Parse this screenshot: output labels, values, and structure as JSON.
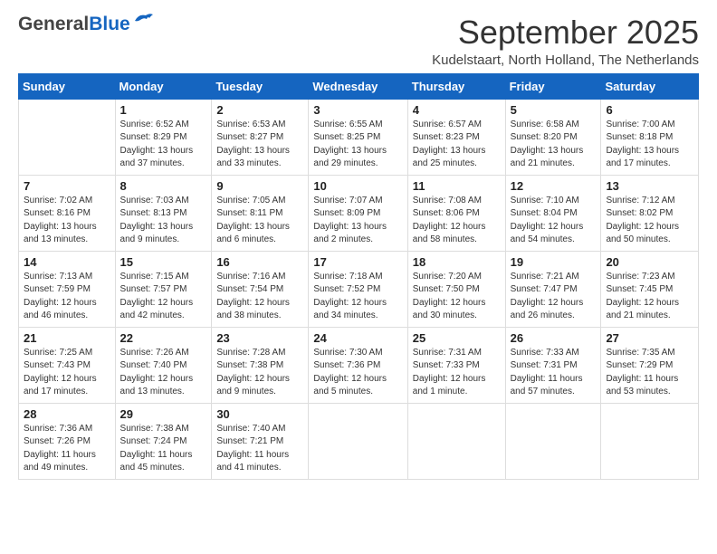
{
  "header": {
    "logo_general": "General",
    "logo_blue": "Blue",
    "month_title": "September 2025",
    "location": "Kudelstaart, North Holland, The Netherlands"
  },
  "days_of_week": [
    "Sunday",
    "Monday",
    "Tuesday",
    "Wednesday",
    "Thursday",
    "Friday",
    "Saturday"
  ],
  "weeks": [
    [
      {
        "day": "",
        "info": ""
      },
      {
        "day": "1",
        "info": "Sunrise: 6:52 AM\nSunset: 8:29 PM\nDaylight: 13 hours\nand 37 minutes."
      },
      {
        "day": "2",
        "info": "Sunrise: 6:53 AM\nSunset: 8:27 PM\nDaylight: 13 hours\nand 33 minutes."
      },
      {
        "day": "3",
        "info": "Sunrise: 6:55 AM\nSunset: 8:25 PM\nDaylight: 13 hours\nand 29 minutes."
      },
      {
        "day": "4",
        "info": "Sunrise: 6:57 AM\nSunset: 8:23 PM\nDaylight: 13 hours\nand 25 minutes."
      },
      {
        "day": "5",
        "info": "Sunrise: 6:58 AM\nSunset: 8:20 PM\nDaylight: 13 hours\nand 21 minutes."
      },
      {
        "day": "6",
        "info": "Sunrise: 7:00 AM\nSunset: 8:18 PM\nDaylight: 13 hours\nand 17 minutes."
      }
    ],
    [
      {
        "day": "7",
        "info": "Sunrise: 7:02 AM\nSunset: 8:16 PM\nDaylight: 13 hours\nand 13 minutes."
      },
      {
        "day": "8",
        "info": "Sunrise: 7:03 AM\nSunset: 8:13 PM\nDaylight: 13 hours\nand 9 minutes."
      },
      {
        "day": "9",
        "info": "Sunrise: 7:05 AM\nSunset: 8:11 PM\nDaylight: 13 hours\nand 6 minutes."
      },
      {
        "day": "10",
        "info": "Sunrise: 7:07 AM\nSunset: 8:09 PM\nDaylight: 13 hours\nand 2 minutes."
      },
      {
        "day": "11",
        "info": "Sunrise: 7:08 AM\nSunset: 8:06 PM\nDaylight: 12 hours\nand 58 minutes."
      },
      {
        "day": "12",
        "info": "Sunrise: 7:10 AM\nSunset: 8:04 PM\nDaylight: 12 hours\nand 54 minutes."
      },
      {
        "day": "13",
        "info": "Sunrise: 7:12 AM\nSunset: 8:02 PM\nDaylight: 12 hours\nand 50 minutes."
      }
    ],
    [
      {
        "day": "14",
        "info": "Sunrise: 7:13 AM\nSunset: 7:59 PM\nDaylight: 12 hours\nand 46 minutes."
      },
      {
        "day": "15",
        "info": "Sunrise: 7:15 AM\nSunset: 7:57 PM\nDaylight: 12 hours\nand 42 minutes."
      },
      {
        "day": "16",
        "info": "Sunrise: 7:16 AM\nSunset: 7:54 PM\nDaylight: 12 hours\nand 38 minutes."
      },
      {
        "day": "17",
        "info": "Sunrise: 7:18 AM\nSunset: 7:52 PM\nDaylight: 12 hours\nand 34 minutes."
      },
      {
        "day": "18",
        "info": "Sunrise: 7:20 AM\nSunset: 7:50 PM\nDaylight: 12 hours\nand 30 minutes."
      },
      {
        "day": "19",
        "info": "Sunrise: 7:21 AM\nSunset: 7:47 PM\nDaylight: 12 hours\nand 26 minutes."
      },
      {
        "day": "20",
        "info": "Sunrise: 7:23 AM\nSunset: 7:45 PM\nDaylight: 12 hours\nand 21 minutes."
      }
    ],
    [
      {
        "day": "21",
        "info": "Sunrise: 7:25 AM\nSunset: 7:43 PM\nDaylight: 12 hours\nand 17 minutes."
      },
      {
        "day": "22",
        "info": "Sunrise: 7:26 AM\nSunset: 7:40 PM\nDaylight: 12 hours\nand 13 minutes."
      },
      {
        "day": "23",
        "info": "Sunrise: 7:28 AM\nSunset: 7:38 PM\nDaylight: 12 hours\nand 9 minutes."
      },
      {
        "day": "24",
        "info": "Sunrise: 7:30 AM\nSunset: 7:36 PM\nDaylight: 12 hours\nand 5 minutes."
      },
      {
        "day": "25",
        "info": "Sunrise: 7:31 AM\nSunset: 7:33 PM\nDaylight: 12 hours\nand 1 minute."
      },
      {
        "day": "26",
        "info": "Sunrise: 7:33 AM\nSunset: 7:31 PM\nDaylight: 11 hours\nand 57 minutes."
      },
      {
        "day": "27",
        "info": "Sunrise: 7:35 AM\nSunset: 7:29 PM\nDaylight: 11 hours\nand 53 minutes."
      }
    ],
    [
      {
        "day": "28",
        "info": "Sunrise: 7:36 AM\nSunset: 7:26 PM\nDaylight: 11 hours\nand 49 minutes."
      },
      {
        "day": "29",
        "info": "Sunrise: 7:38 AM\nSunset: 7:24 PM\nDaylight: 11 hours\nand 45 minutes."
      },
      {
        "day": "30",
        "info": "Sunrise: 7:40 AM\nSunset: 7:21 PM\nDaylight: 11 hours\nand 41 minutes."
      },
      {
        "day": "",
        "info": ""
      },
      {
        "day": "",
        "info": ""
      },
      {
        "day": "",
        "info": ""
      },
      {
        "day": "",
        "info": ""
      }
    ]
  ]
}
